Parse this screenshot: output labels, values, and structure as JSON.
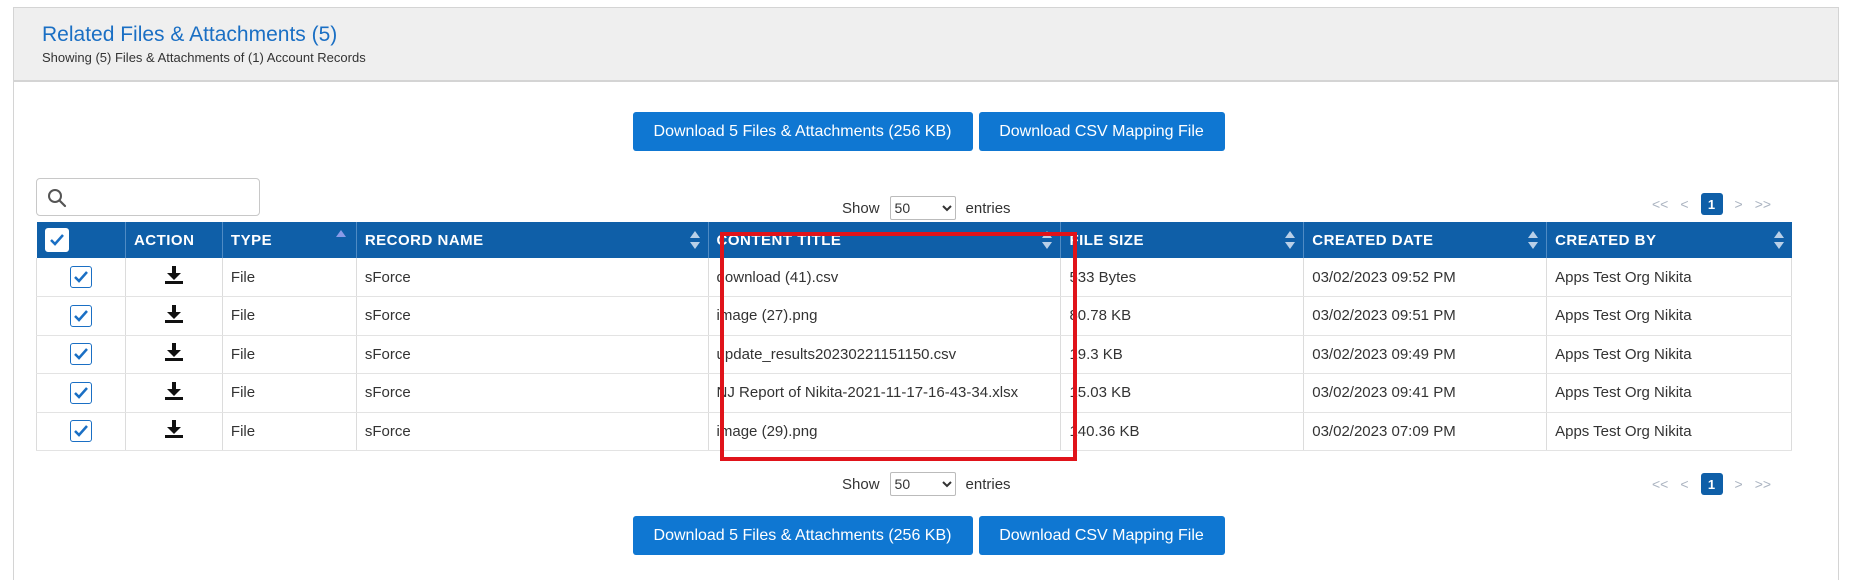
{
  "header": {
    "title": "Related Files & Attachments (5)",
    "subtitle": "Showing (5) Files & Attachments of (1) Account Records"
  },
  "buttons": {
    "download_label": "Download 5 Files & Attachments (256 KB)",
    "csv_label": "Download CSV Mapping File"
  },
  "search": {
    "placeholder": ""
  },
  "show_entries": {
    "show": "Show",
    "value": "50",
    "entries": "entries"
  },
  "pager": {
    "first": "<<",
    "prev": "<",
    "current": "1",
    "next": ">",
    "last": ">>"
  },
  "table": {
    "columns": [
      "ACTION",
      "TYPE",
      "RECORD NAME",
      "CONTENT TITLE",
      "FILE SIZE",
      "CREATED DATE",
      "CREATED BY"
    ],
    "rows": [
      {
        "type": "File",
        "record": "sForce",
        "title": "download (41).csv",
        "size": "533 Bytes",
        "date": "03/02/2023 09:52 PM",
        "by": "Apps Test Org Nikita"
      },
      {
        "type": "File",
        "record": "sForce",
        "title": "image (27).png",
        "size": "80.78 KB",
        "date": "03/02/2023 09:51 PM",
        "by": "Apps Test Org Nikita"
      },
      {
        "type": "File",
        "record": "sForce",
        "title": "update_results20230221151150.csv",
        "size": "19.3 KB",
        "date": "03/02/2023 09:49 PM",
        "by": "Apps Test Org Nikita"
      },
      {
        "type": "File",
        "record": "sForce",
        "title": "NJ Report of Nikita-2021-11-17-16-43-34.xlsx",
        "size": "15.03 KB",
        "date": "03/02/2023 09:41 PM",
        "by": "Apps Test Org Nikita"
      },
      {
        "type": "File",
        "record": "sForce",
        "title": "image (29).png",
        "size": "140.36 KB",
        "date": "03/02/2023 07:09 PM",
        "by": "Apps Test Org Nikita"
      }
    ]
  },
  "colors": {
    "accent": "#0f5fa8",
    "button": "#0f77d2",
    "link": "#1a7fd4",
    "highlight": "#e0131a"
  },
  "icons": [
    "search-icon",
    "download-icon",
    "checkbox-checked-icon",
    "sort-icon"
  ]
}
